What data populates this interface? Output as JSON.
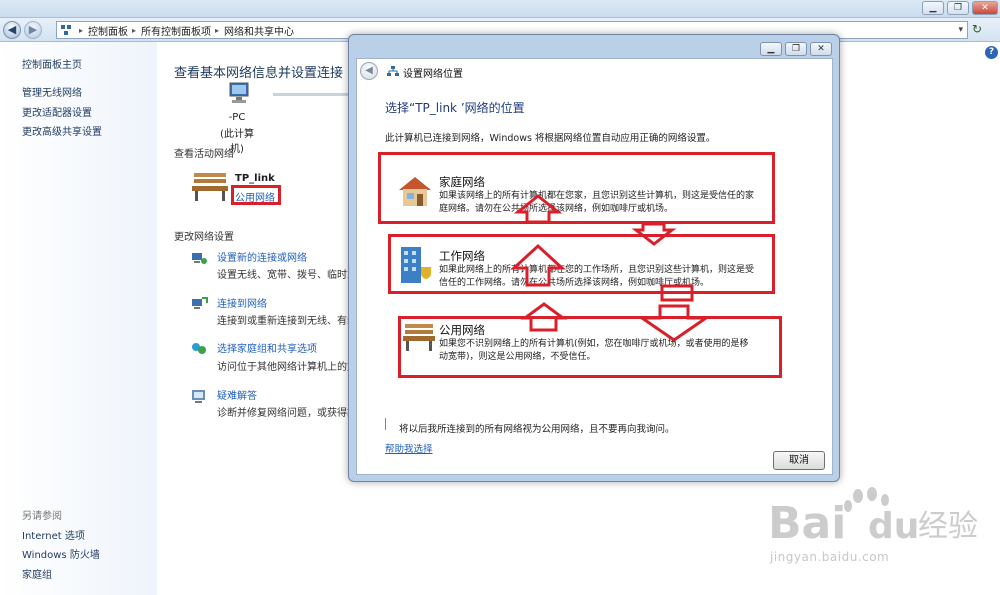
{
  "window": {
    "controls": {
      "minimize": "▁",
      "maximize": "❐",
      "close": "✕"
    }
  },
  "address_bar": {
    "back_icon": "back-arrow-icon",
    "forward_icon": "forward-arrow-icon",
    "breadcrumbs": [
      "控制面板",
      "所有控制面板项",
      "网络和共享中心"
    ],
    "refresh_icon": "refresh-icon"
  },
  "sidebar": {
    "home": "控制面板主页",
    "items": [
      "管理无线网络",
      "更改适配器设置",
      "更改高级共享设置"
    ],
    "see_also_header": "另请参阅",
    "see_also": [
      "Internet 选项",
      "Windows 防火墙",
      "家庭组"
    ]
  },
  "main": {
    "heading": "查看基本网络信息并设置连接",
    "computer_name": "-PC",
    "computer_sub": "(此计算机)",
    "active_networks_title": "查看活动网络",
    "network": {
      "name": "TP_link",
      "type": "公用网络"
    },
    "change_settings_title": "更改网络设置",
    "tasks": [
      {
        "link": "设置新的连接或网络",
        "desc": "设置无线、宽带、拨号、临时或"
      },
      {
        "link": "连接到网络",
        "desc": "连接到或重新连接到无线、有线"
      },
      {
        "link": "选择家庭组和共享选项",
        "desc": "访问位于其他网络计算机上的文"
      },
      {
        "link": "疑难解答",
        "desc": "诊断并修复网络问题，或获得故"
      }
    ]
  },
  "dialog": {
    "title": "设置网络位置",
    "heading": "选择“TP_link ’网络的位置",
    "intro": "此计算机已连接到网络，Windows 将根据网络位置自动应用正确的网络设置。",
    "options": [
      {
        "title": "家庭网络",
        "desc_lines": [
          "如果该网络上的所有计算机都在您家，且您识别这些计算机，则这是受信任的家",
          "庭网络。请勿在公共场所选择该网络，例如咖啡厅或机场。"
        ]
      },
      {
        "title": "工作网络",
        "desc_lines": [
          "如果此网络上的所有计算机都在您的工作场所，且您识别这些计算机，则这是受",
          "信任的工作网络。请勿在公共场所选择该网络，例如咖啡厅或机场。"
        ]
      },
      {
        "title": "公用网络",
        "desc_lines": [
          "如果您不识别网络上的所有计算机(例如，您在咖啡厅或机场，或者使用的是移",
          "动宽带)，则这是公用网络，不受信任。"
        ]
      }
    ],
    "checkbox_label": "将以后我所连接到的所有网络视为公用网络，且不要再向我询问。",
    "help_link": "帮助我选择",
    "cancel": "取消",
    "highlight_color": "#d9202a"
  },
  "watermark": {
    "logo_text": "Bai",
    "logo_text2": "du",
    "logo_cn": "经验",
    "url": "jingyan.baidu.com"
  }
}
